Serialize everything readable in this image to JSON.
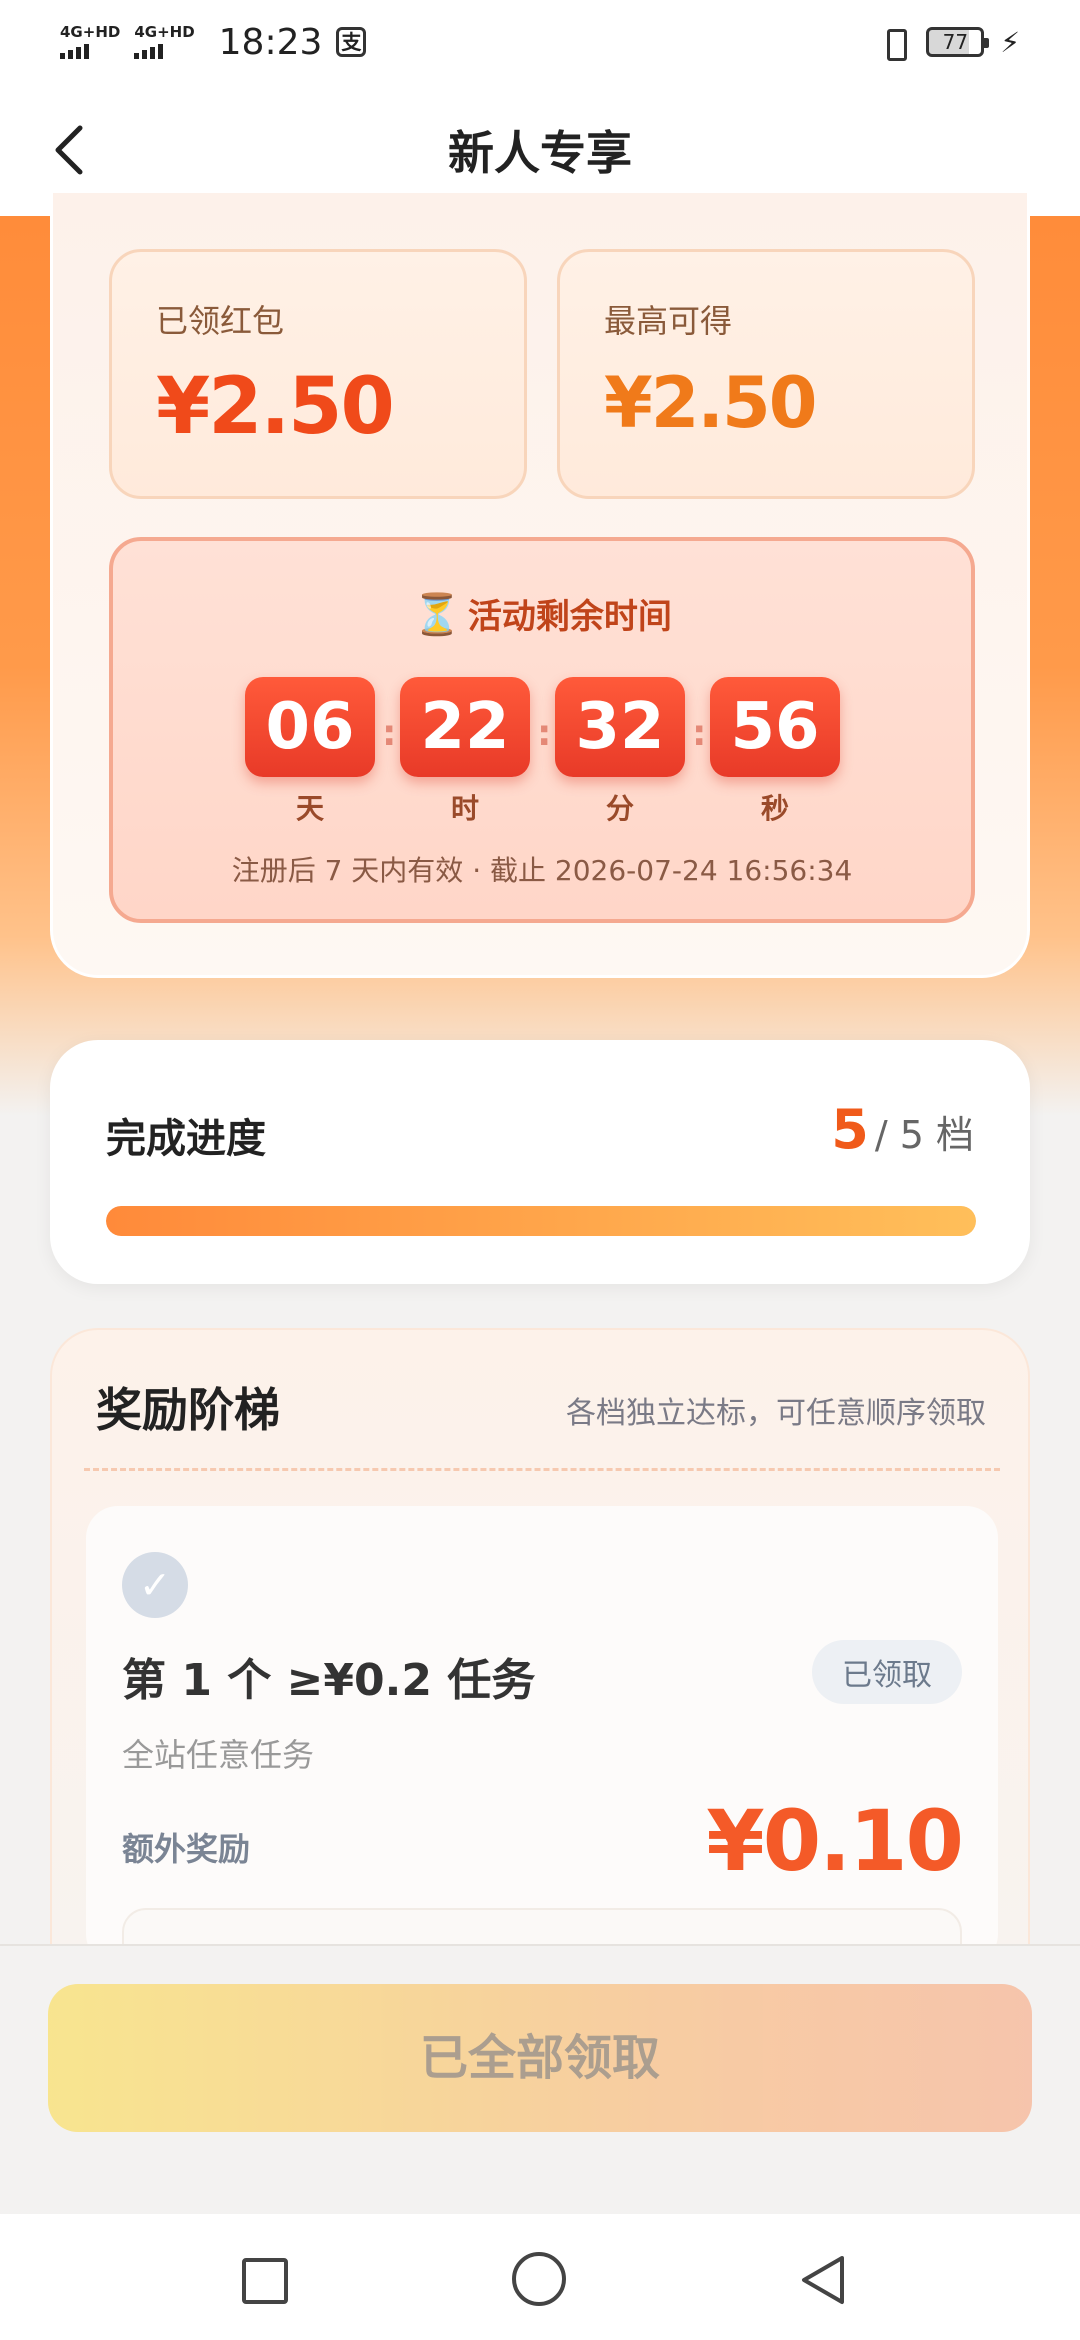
{
  "status": {
    "signal1": "4G+HD",
    "signal2": "4G+HD",
    "time": "18:23",
    "battery": "77"
  },
  "nav": {
    "title": "新人专享"
  },
  "stats": {
    "claimed_label": "已领红包",
    "claimed_value": "¥2.50",
    "max_label": "最高可得",
    "max_value": "¥2.50"
  },
  "countdown": {
    "title": "活动剩余时间",
    "days": "06",
    "hours": "22",
    "minutes": "32",
    "seconds": "56",
    "day_label": "天",
    "hour_label": "时",
    "minute_label": "分",
    "second_label": "秒",
    "note": "注册后 7 天内有效 · 截止 2026-07-24 16:56:34"
  },
  "progress": {
    "title": "完成进度",
    "done": "5",
    "total_text": "/ 5 档",
    "fraction": 1.0
  },
  "rewards": {
    "title": "奖励阶梯",
    "subtitle": "各档独立达标，可任意顺序领取",
    "tiers": [
      {
        "name": "第 1 个 ≥¥0.2 任务",
        "badge": "已领取",
        "desc": "全站任意任务",
        "extra_label": "额外奖励",
        "extra_value": "¥0.10"
      }
    ]
  },
  "footer": {
    "claim_label": "已全部领取"
  },
  "colors": {
    "accent": "#f05a1a",
    "hero": "#ff8c3a",
    "countdown_tile": "#e83a28"
  }
}
